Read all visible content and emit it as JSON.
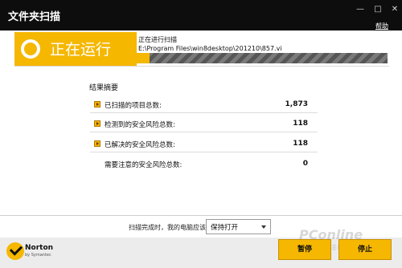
{
  "window": {
    "title": "文件夹扫描",
    "help_label": "帮助",
    "min_glyph": "—",
    "max_glyph": "□",
    "close_glyph": "✕"
  },
  "status": {
    "banner_text": "正在运行",
    "scan_label": "正在进行扫描",
    "scan_path": "E:\\Program Files\\win8desktop\\201210\\857.vi",
    "progress": 0.05
  },
  "results": {
    "heading": "结果摘要",
    "rows": [
      {
        "label": "已扫描的项目总数:",
        "value": "1,873"
      },
      {
        "label": "检测到的安全风险总数:",
        "value": "118"
      },
      {
        "label": "已解决的安全风险总数:",
        "value": "118"
      },
      {
        "label": "需要注意的安全风险总数:",
        "value": "0"
      }
    ]
  },
  "footer": {
    "after_scan_label": "扫描完成时，我的电脑应该:",
    "after_scan_value": "保持打开",
    "pause_label": "暂停",
    "stop_label": "停止",
    "logo_text": "Norton",
    "logo_sub": "by Symantec",
    "watermark": "PConline",
    "watermark_sub": "太平洋电脑网"
  },
  "colors": {
    "accent": "#f5b700",
    "titlebar": "#0d0d0d"
  }
}
